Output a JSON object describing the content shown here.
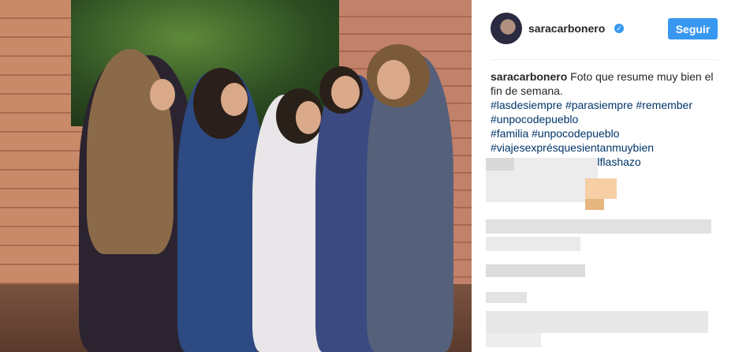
{
  "post": {
    "username": "saracarbonero",
    "follow_label": "Seguir",
    "caption_text": "Foto que resume muy bien el fin de semana.",
    "hashtags": [
      "#lasdesiempre #parasiempre #remember",
      "#unpocodepueblo",
      "#familia #unpocodepueblo",
      "#viajesexprésquesientanmuybien",
      "#mipeloselleovótodoelflashazo"
    ]
  },
  "colors": {
    "accent": "#3897f0",
    "hashtag": "#003569",
    "text": "#262626"
  },
  "icons": {
    "verified": "verified-badge-icon"
  }
}
